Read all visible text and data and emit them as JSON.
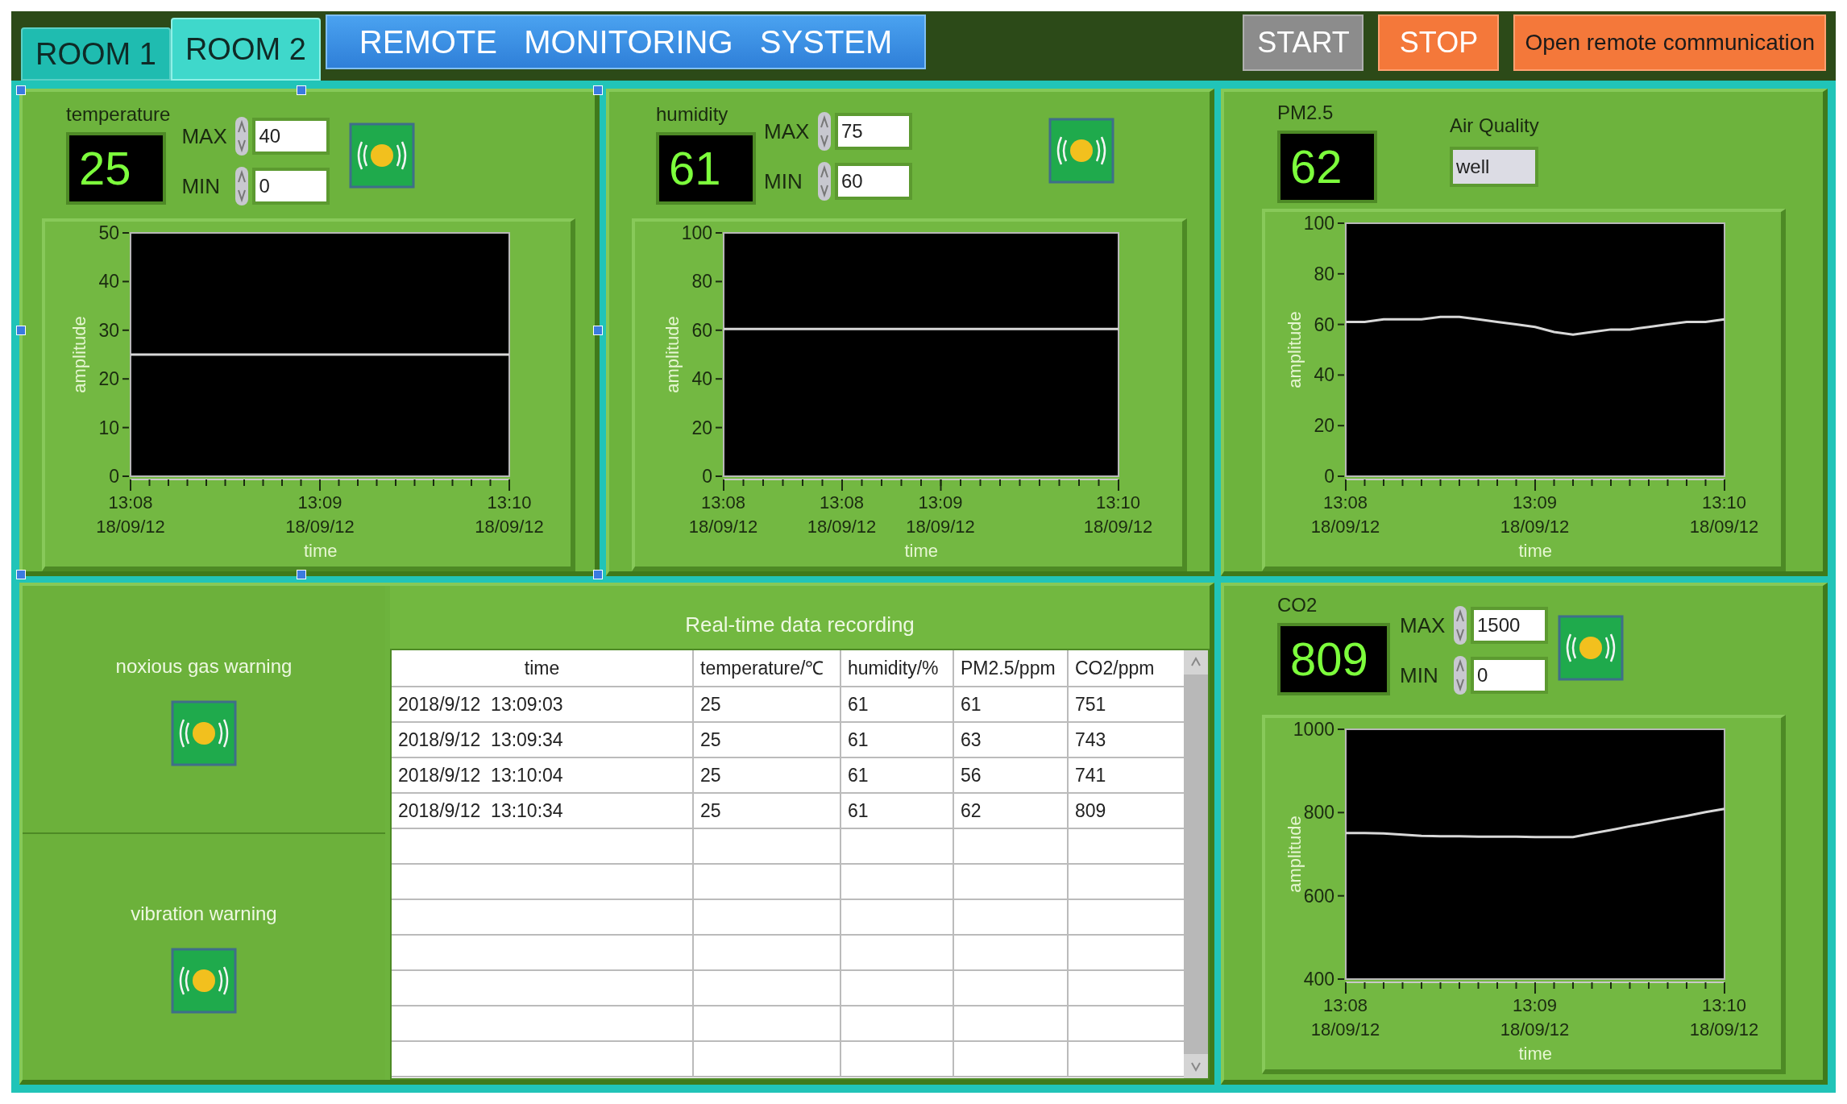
{
  "tabs": [
    {
      "label": "ROOM 1",
      "selected": false
    },
    {
      "label": "ROOM 2",
      "selected": true
    }
  ],
  "title": "REMOTE   MONITORING   SYSTEM",
  "buttons": [
    {
      "label": "START",
      "kind": "grey"
    },
    {
      "label": "STOP",
      "kind": "orange"
    },
    {
      "label": "Open remote communication",
      "kind": "orange"
    }
  ],
  "temperature": {
    "label": "temperature",
    "value": "25",
    "max_label": "MAX",
    "max": "40",
    "min_label": "MIN",
    "min": "0",
    "chart_data": {
      "type": "line",
      "xlabel": "time",
      "ylabel": "amplitude",
      "categories": [
        "13:08 18/09/12",
        null,
        null,
        null,
        null,
        null,
        null,
        null,
        null,
        null,
        "13:09 18/09/12",
        null,
        null,
        null,
        null,
        null,
        null,
        null,
        null,
        null,
        "13:10 18/09/12"
      ],
      "series": [
        {
          "color": "#d8d8d8",
          "values": [
            25,
            25,
            25,
            25,
            25,
            25,
            25,
            25,
            25,
            25,
            25,
            25,
            25,
            25,
            25,
            25,
            25,
            25,
            25,
            25,
            25
          ]
        }
      ],
      "ylim": [
        0,
        50
      ],
      "yticks": [
        0,
        10,
        20,
        30,
        40,
        50
      ]
    }
  },
  "humidity": {
    "label": "humidity",
    "value": "61",
    "max_label": "MAX",
    "max": "75",
    "min_label": "MIN",
    "min": "60",
    "chart_data": {
      "type": "line",
      "xlabel": "time",
      "ylabel": "amplitude",
      "categories": [
        "13:08 18/09/12",
        null,
        null,
        null,
        null,
        null,
        "13:08 18/09/12",
        null,
        null,
        null,
        null,
        "13:09 18/09/12",
        null,
        null,
        null,
        null,
        null,
        null,
        null,
        null,
        "13:10 18/09/12"
      ],
      "series": [
        {
          "color": "#d8d8d8",
          "values": [
            60.5,
            60.5,
            60.5,
            60.5,
            60.5,
            60.5,
            60.5,
            60.5,
            60.5,
            60.5,
            60.5,
            60.5,
            60.5,
            60.5,
            60.5,
            60.5,
            60.5,
            60.5,
            60.5,
            60.5,
            60.5
          ]
        }
      ],
      "ylim": [
        0,
        100
      ],
      "yticks": [
        0,
        20,
        40,
        60,
        80,
        100
      ]
    }
  },
  "pm25": {
    "label": "PM2.5",
    "value": "62",
    "quality_label": "Air Quality",
    "quality": "well",
    "chart_data": {
      "type": "line",
      "xlabel": "time",
      "ylabel": "amplitude",
      "categories": [
        "13:08 18/09/12",
        null,
        null,
        null,
        null,
        null,
        null,
        null,
        null,
        null,
        "13:09 18/09/12",
        null,
        null,
        null,
        null,
        null,
        null,
        null,
        null,
        null,
        "13:10 18/09/12"
      ],
      "series": [
        {
          "color": "#d8d8d8",
          "values": [
            61,
            61,
            62,
            62,
            62,
            63,
            63,
            62,
            61,
            60,
            59,
            57,
            56,
            57,
            58,
            58,
            59,
            60,
            61,
            61,
            62
          ]
        }
      ],
      "ylim": [
        0,
        100
      ],
      "yticks": [
        0,
        20,
        40,
        60,
        80,
        100
      ]
    }
  },
  "warnings": [
    {
      "label": "noxious gas warning"
    },
    {
      "label": "vibration warning"
    }
  ],
  "table": {
    "title": "Real-time data recording",
    "columns": [
      "time",
      "temperature/℃",
      "humidity/%",
      "PM2.5/ppm",
      "CO2/ppm"
    ],
    "rows": [
      [
        "2018/9/12  13:09:03",
        "25",
        "61",
        "61",
        "751"
      ],
      [
        "2018/9/12  13:09:34",
        "25",
        "61",
        "63",
        "743"
      ],
      [
        "2018/9/12  13:10:04",
        "25",
        "61",
        "56",
        "741"
      ],
      [
        "2018/9/12  13:10:34",
        "25",
        "61",
        "62",
        "809"
      ]
    ]
  },
  "co2": {
    "label": "CO2",
    "value": "809",
    "max_label": "MAX",
    "max": "1500",
    "min_label": "MIN",
    "min": "0",
    "chart_data": {
      "type": "line",
      "xlabel": "time",
      "ylabel": "amplitude",
      "categories": [
        "13:08 18/09/12",
        null,
        null,
        null,
        null,
        null,
        null,
        null,
        null,
        null,
        "13:09 18/09/12",
        null,
        null,
        null,
        null,
        null,
        null,
        null,
        null,
        null,
        "13:10 18/09/12"
      ],
      "series": [
        {
          "color": "#d8d8d8",
          "values": [
            751,
            751,
            750,
            747,
            744,
            743,
            743,
            742,
            742,
            742,
            741,
            741,
            741,
            750,
            758,
            767,
            775,
            784,
            792,
            801,
            809
          ]
        }
      ],
      "ylim": [
        400,
        1000
      ],
      "yticks": [
        400,
        600,
        800,
        1000
      ]
    }
  }
}
